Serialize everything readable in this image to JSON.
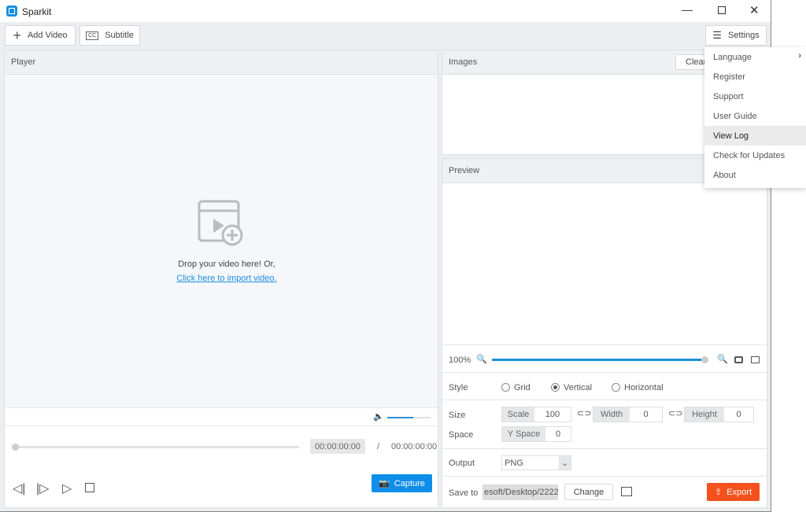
{
  "app": {
    "title": "Sparkit"
  },
  "toolbar": {
    "add_video": "Add Video",
    "subtitle": "Subtitle",
    "settings": "Settings"
  },
  "player": {
    "title": "Player",
    "drop_text": "Drop your video here! Or,",
    "import_link": "Click here to import video.",
    "current_time": "00:00:00:00",
    "separator": "/",
    "total_time": "00:00:00:00",
    "capture": "Capture",
    "volume": 0.6,
    "progress": 0
  },
  "images": {
    "title": "Images",
    "clear": "Clear"
  },
  "preview": {
    "title": "Preview",
    "zoom": "100%",
    "zoom_level": 1.0
  },
  "style": {
    "label": "Style",
    "options": [
      "Grid",
      "Vertical",
      "Horizontal"
    ],
    "selected": "Vertical"
  },
  "size": {
    "label": "Size",
    "scale_label": "Scale",
    "scale": "100",
    "width_label": "Width",
    "width": "0",
    "height_label": "Height",
    "height": "0"
  },
  "space": {
    "label": "Space",
    "y_label": "Y Space",
    "y": "0"
  },
  "output": {
    "label": "Output",
    "format": "PNG"
  },
  "save": {
    "label": "Save to",
    "path": "esoft/Desktop/2222",
    "change": "Change",
    "export": "Export"
  },
  "menu": {
    "items": [
      "Language",
      "Register",
      "Support",
      "User Guide",
      "View Log",
      "Check for Updates",
      "About"
    ],
    "highlighted": "View Log"
  },
  "colors": {
    "accent": "#0e8ee9",
    "export": "#f4511e"
  }
}
